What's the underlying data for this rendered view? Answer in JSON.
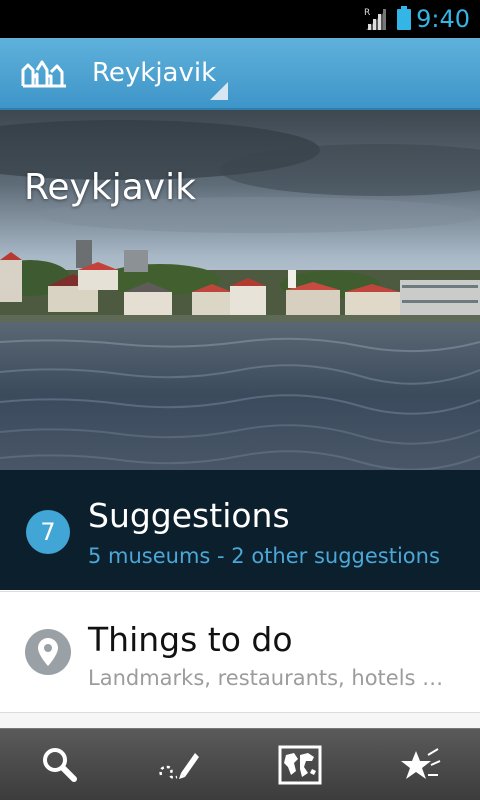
{
  "status_bar": {
    "time": "9:40",
    "roaming_indicator": "R",
    "icons": [
      "signal-icon",
      "battery-icon"
    ]
  },
  "action_bar": {
    "logo_icon": "city-skyline-logo-icon",
    "city_selector_value": "Reykjavik"
  },
  "hero": {
    "title": "Reykjavik"
  },
  "sections": {
    "suggestions": {
      "count": "7",
      "title": "Suggestions",
      "subtitle": "5 museums - 2 other suggestions"
    },
    "things_to_do": {
      "icon": "map-pin-icon",
      "title": "Things to do",
      "subtitle": "Landmarks, restaurants, hotels …"
    }
  },
  "bottom_bar": {
    "buttons": [
      "search-icon",
      "edit-route-icon",
      "world-map-icon",
      "favorites-star-icon"
    ]
  },
  "colors": {
    "accent": "#33b5e5",
    "action_bar": "#4aa2d2",
    "suggestions_bg": "#0c1f2c",
    "suggestions_sub": "#4aa7d8",
    "badge": "#41a5d6"
  }
}
